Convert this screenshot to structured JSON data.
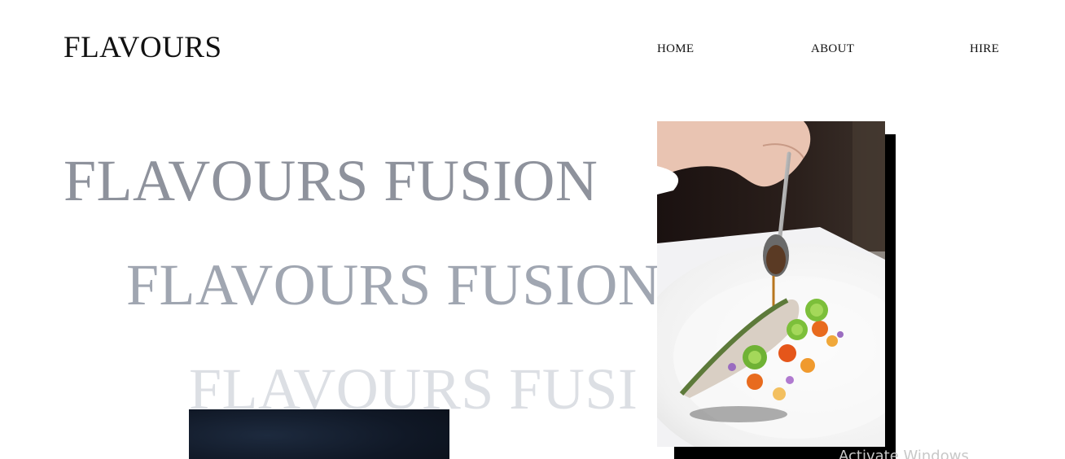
{
  "brand": {
    "logo_text": "FLAVOURS"
  },
  "nav": {
    "home": "HOME",
    "about": "ABOUT",
    "hire": "HIRE"
  },
  "hero": {
    "lines": [
      "FLAVOURS FUSION",
      "FLAVOURS FUSION",
      "FLAVOURS FUSI"
    ]
  },
  "overlay": {
    "watermark": "Activate Windows"
  },
  "colors": {
    "text": "#111111",
    "hero_1": "#8e929c",
    "hero_2": "#a0a6b1",
    "hero_3": "#dcdfe4"
  }
}
